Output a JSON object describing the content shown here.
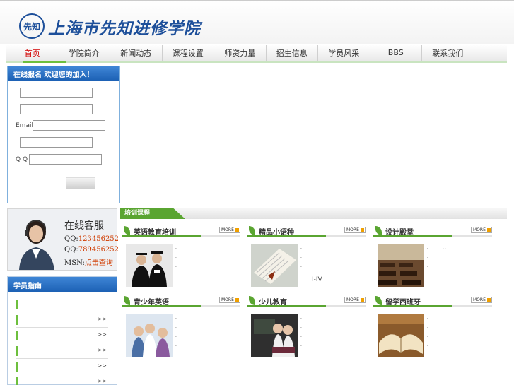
{
  "site": {
    "logo_seal": "先知",
    "name": "上海市先知进修学院"
  },
  "nav": {
    "items": [
      "首页",
      "学院简介",
      "新闻动态",
      "课程设置",
      "师资力量",
      "招生信息",
      "学员风采",
      "BBS",
      "联系我们"
    ]
  },
  "register": {
    "title": "在线报名 欢迎您的加入！",
    "email_label": "Email",
    "qq_label": "Q Q"
  },
  "service": {
    "title": "在线客服",
    "qq1_label": "QQ:",
    "qq1_value": "123456252",
    "qq2_label": "QQ:",
    "qq2_value": "789456252",
    "msn_label": "MSN:",
    "msn_value": "点击查询"
  },
  "guide": {
    "title": "学员指南",
    "arrows": ">>"
  },
  "courses": {
    "section_title": "培训课程",
    "more_label": "MORE",
    "cards": [
      {
        "title": "英语教育培训"
      },
      {
        "title": "精品小语种",
        "note": "I-IV"
      },
      {
        "title": "设计殿堂",
        "note": ".."
      },
      {
        "title": "青少年英语"
      },
      {
        "title": "少儿教育"
      },
      {
        "title": "留学西班牙"
      }
    ]
  },
  "colors": {
    "brand_blue": "#1d4f9a",
    "accent_green": "#5aa531",
    "nav_active": "#d20000",
    "title_blue": "#1b5fb3"
  }
}
